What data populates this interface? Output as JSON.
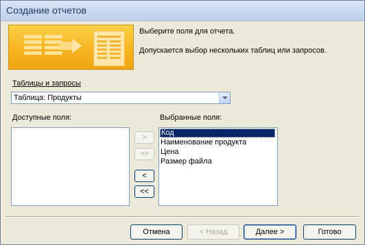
{
  "window": {
    "title": "Создание отчетов"
  },
  "intro": {
    "line1": "Выберите поля для отчета.",
    "line2": "Допускается выбор нескольких таблиц или запросов."
  },
  "source": {
    "label": "Таблицы и запросы",
    "selected": "Таблица: Продукты"
  },
  "available": {
    "label": "Доступные поля:",
    "items": []
  },
  "selected": {
    "label": "Выбранные поля:",
    "items": [
      "Код",
      "Наименование продукта",
      "Цена",
      "Размер файла"
    ],
    "highlighted_index": 0
  },
  "move_buttons": {
    "add": ">",
    "add_all": ">>",
    "remove": "<",
    "remove_all": "<<"
  },
  "footer": {
    "cancel": "Отмена",
    "back": "< Назад",
    "next": "Далее >",
    "finish": "Готово"
  },
  "colors": {
    "banner": "#f7b522",
    "selection": "#0a246a",
    "dialog": "#ece9d8"
  }
}
